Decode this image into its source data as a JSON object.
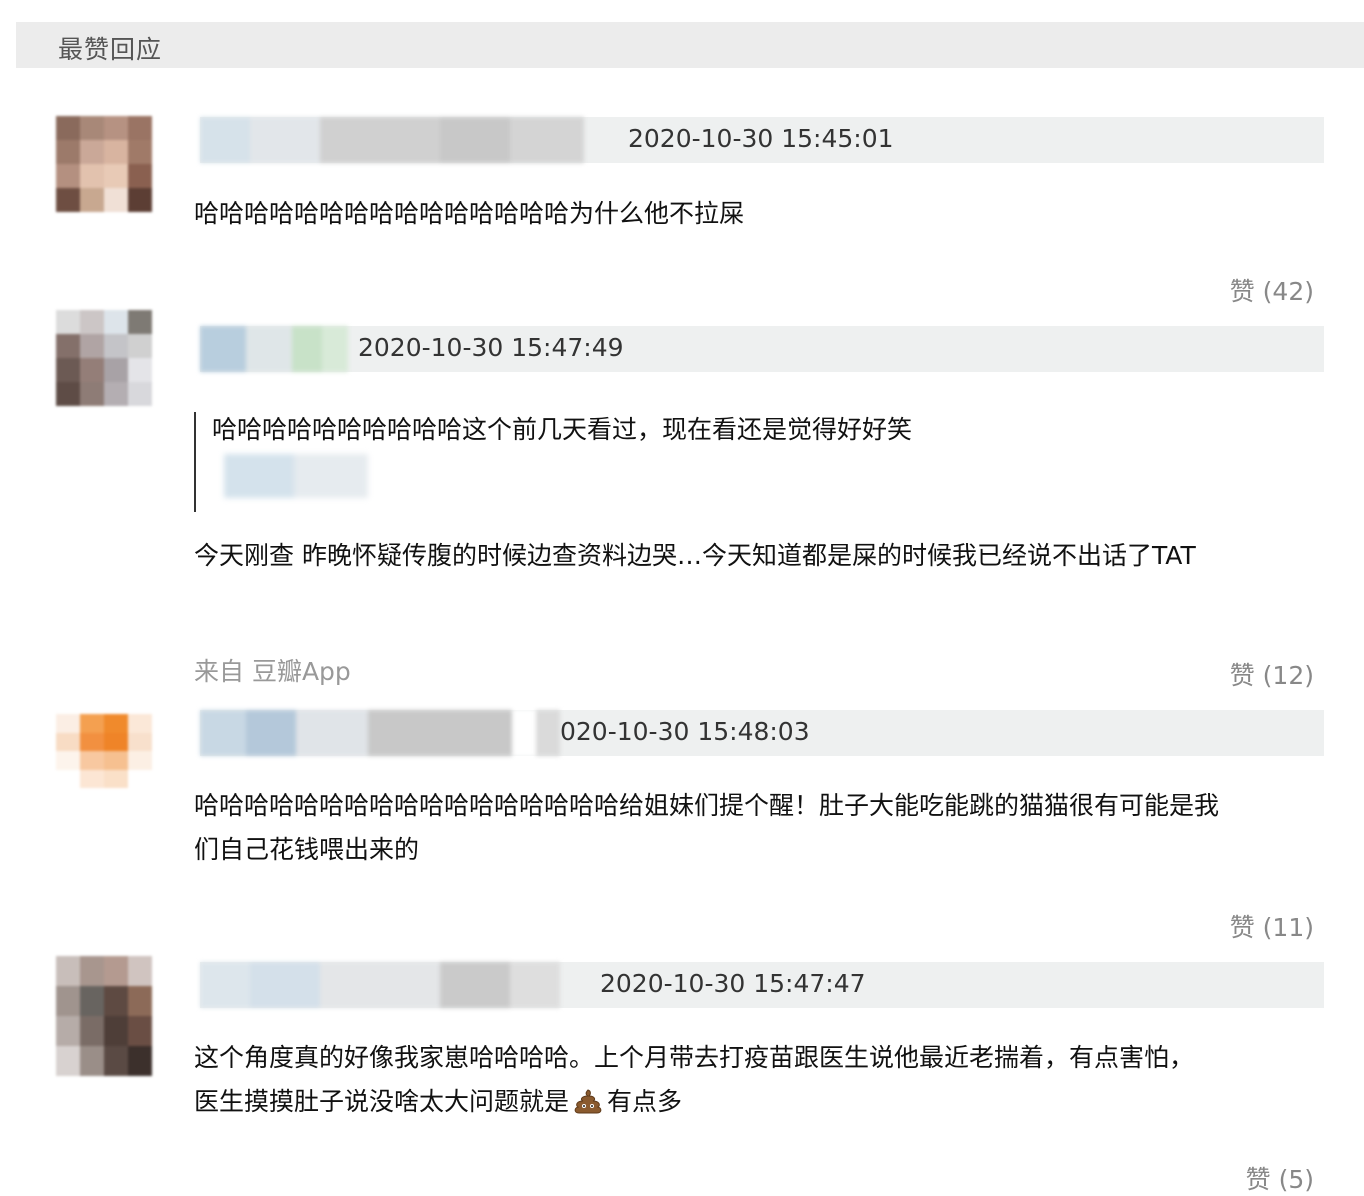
{
  "header": {
    "title": "最赞回应"
  },
  "comments": [
    {
      "timestamp": "2020-10-30 15:45:01",
      "text": "哈哈哈哈哈哈哈哈哈哈哈哈哈哈哈为什么他不拉屎",
      "like_label": "赞 (42)"
    },
    {
      "timestamp": "2020-10-30 15:47:49",
      "quote": "哈哈哈哈哈哈哈哈哈哈这个前几天看过，现在看还是觉得好好笑",
      "text": "今天刚查 昨晚怀疑传腹的时候边查资料边哭…今天知道都是屎的时候我已经说不出话了TAT",
      "source": "来自 豆瓣App",
      "like_label": "赞 (12)"
    },
    {
      "timestamp": "020-10-30 15:48:03",
      "text_line1": "哈哈哈哈哈哈哈哈哈哈哈哈哈哈哈哈哈给姐妹们提个醒！肚子大能吃能跳的猫猫很有可能是我",
      "text_line2": "们自己花钱喂出来的",
      "like_label": "赞 (11)"
    },
    {
      "timestamp": "2020-10-30 15:47:47",
      "text_line1": "这个角度真的好像我家崽哈哈哈哈。上个月带去打疫苗跟医生说他最近老揣着，有点害怕，",
      "text_line2_a": "医生摸摸肚子说没啥太大问题就是",
      "text_line2_b": "有点多",
      "like_label": "赞 (5)"
    }
  ],
  "icons": {
    "emoji": "poop-icon"
  },
  "colors": {
    "header_bg": "#ececec",
    "meta_bg": "#eef0f0",
    "like": "#888888"
  }
}
